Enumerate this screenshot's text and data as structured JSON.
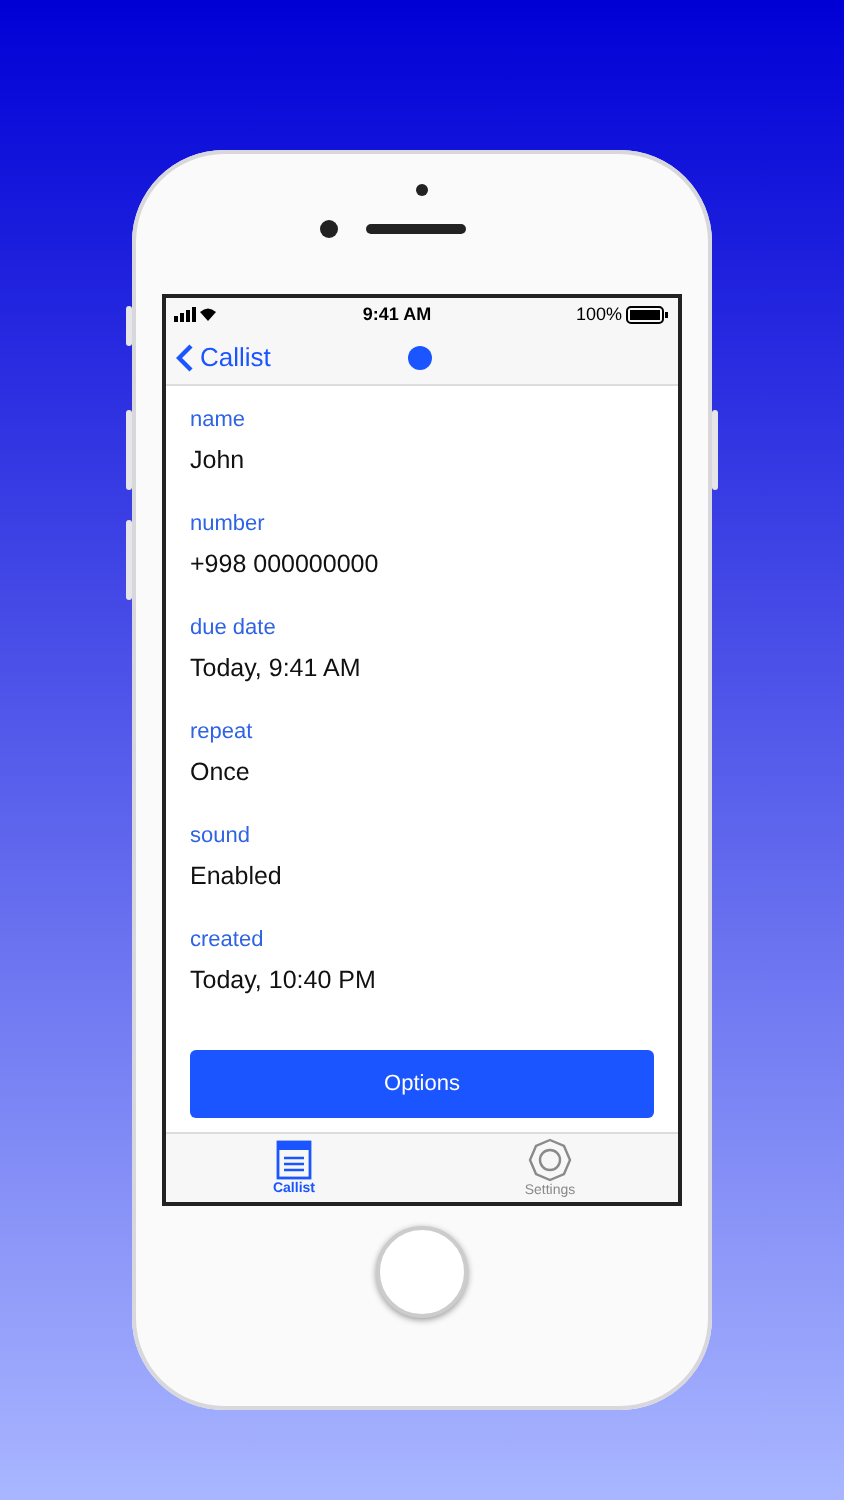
{
  "status_bar": {
    "time": "9:41 AM",
    "battery": "100%"
  },
  "nav": {
    "back_label": "Callist"
  },
  "fields": [
    {
      "label": "name",
      "value": "John"
    },
    {
      "label": "number",
      "value": "+998 000000000"
    },
    {
      "label": "due date",
      "value": "Today, 9:41 AM"
    },
    {
      "label": "repeat",
      "value": "Once"
    },
    {
      "label": "sound",
      "value": "Enabled"
    },
    {
      "label": "created",
      "value": "Today, 10:40 PM"
    }
  ],
  "button": "Options",
  "tabs": [
    {
      "label": "Callist",
      "kind": "list",
      "selected": true
    },
    {
      "label": "Settings",
      "kind": "gear",
      "selected": false
    }
  ]
}
